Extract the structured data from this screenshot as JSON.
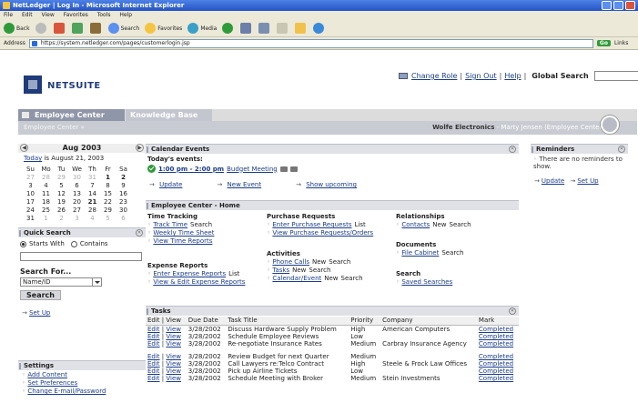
{
  "browser": {
    "title": "NetLedger | Log In - Microsoft Internet Explorer",
    "menu": [
      "File",
      "Edit",
      "View",
      "Favorites",
      "Tools",
      "Help"
    ],
    "toolbar": {
      "back": "Back",
      "search": "Search",
      "favorites": "Favorites",
      "media": "Media"
    },
    "address_label": "Address",
    "address": "https://system.netledger.com/pages/customerlogin.jsp",
    "go": "Go",
    "links": "Links"
  },
  "header": {
    "logo_text": "NETSUITE",
    "change_role": "Change Role",
    "sign_out": "Sign Out",
    "help": "Help",
    "global_search_label": "Global Search",
    "go": "Go"
  },
  "tabs": {
    "active": "Employee Center",
    "inactive": "Knowledge Base",
    "breadcrumb": "Employee Center »",
    "company": "Wolfe Electronics",
    "user": " - Marty Jensen (Employee Center)"
  },
  "calendar": {
    "month": "Aug 2003",
    "today_link": "Today",
    "today_text": " is August 21, 2003",
    "weekdays": [
      "Su",
      "Mo",
      "Tu",
      "We",
      "Th",
      "Fr",
      "Sa"
    ],
    "weeks": [
      [
        "27",
        "28",
        "29",
        "30",
        "31",
        "1",
        "2"
      ],
      [
        "3",
        "4",
        "5",
        "6",
        "7",
        "8",
        "9"
      ],
      [
        "10",
        "11",
        "12",
        "13",
        "14",
        "15",
        "16"
      ],
      [
        "17",
        "18",
        "19",
        "20",
        "21",
        "22",
        "23"
      ],
      [
        "24",
        "25",
        "26",
        "27",
        "28",
        "29",
        "30"
      ],
      [
        "31",
        "1",
        "2",
        "3",
        "4",
        "5",
        "6"
      ]
    ]
  },
  "quick_search": {
    "title": "Quick Search",
    "starts_with": "Starts With",
    "contains": "Contains",
    "search_for": "Search For...",
    "select_value": "Name/ID",
    "search_button": "Search",
    "setup": "Set Up"
  },
  "settings": {
    "title": "Settings",
    "items": [
      "Add Content",
      "Set Preferences",
      "Change E-mail/Password"
    ]
  },
  "calendar_events": {
    "title": "Calendar Events",
    "todays_events": "Today's events:",
    "event_time": "1:00 pm - 2:00 pm",
    "event_name": "Budget Meeting",
    "update": "Update",
    "new_event": "New Event",
    "show_upcoming": "Show upcoming"
  },
  "home": {
    "title": "Employee Center - Home",
    "time_tracking": {
      "h": "Time Tracking",
      "r1": "Track Time",
      "r1b": "Search",
      "r2": "Weekly Time Sheet",
      "r3": "View Time Reports"
    },
    "purchase": {
      "h": "Purchase Requests",
      "r1": "Enter Purchase Requests",
      "r1b": "List",
      "r2": "View Purchase Requests/Orders"
    },
    "relationships": {
      "h": "Relationships",
      "r1": "Contacts",
      "r1b": "New",
      "r1c": "Search"
    },
    "documents": {
      "h": "Documents",
      "r1": "File Cabinet",
      "r1b": "Search"
    },
    "expense": {
      "h": "Expense Reports",
      "r1": "Enter Expense Reports",
      "r1b": "List",
      "r2": "View & Edit Expense Reports"
    },
    "activities": {
      "h": "Activities",
      "r1": "Phone Calls",
      "r1b": "New",
      "r1c": "Search",
      "r2": "Tasks",
      "r2b": "New",
      "r2c": "Search",
      "r3": "Calendar/Event",
      "r3b": "New",
      "r3c": "Search"
    },
    "search": {
      "h": "Search",
      "r1": "Saved Searches"
    }
  },
  "tasks": {
    "title": "Tasks",
    "columns": [
      "Edit | View",
      "Due Date",
      "Task Title",
      "Priority",
      "Company",
      "Mark"
    ],
    "rows": [
      {
        "date": "3/28/2002",
        "title": "Discuss Hardware Supply Problem",
        "priority": "High",
        "company": "American Computers",
        "mark": "Completed"
      },
      {
        "date": "3/28/2002",
        "title": "Schedule Employee Reviews",
        "priority": "Low",
        "company": "",
        "mark": "Completed"
      },
      {
        "date": "3/28/2002",
        "title": "Re-negotiate Insurance Rates",
        "priority": "Medium",
        "company": "Carbray Insurance Agency",
        "mark": "Completed"
      },
      {
        "date": "3/28/2002",
        "title": "Review Budget for next Quarter",
        "priority": "Medium",
        "company": "",
        "mark": "Completed"
      },
      {
        "date": "3/28/2002",
        "title": "Call Lawyers re:Telco Contract",
        "priority": "High",
        "company": "Steele & Frock Law Offices",
        "mark": "Completed"
      },
      {
        "date": "3/28/2002",
        "title": "Pick up Airline Tickets",
        "priority": "Low",
        "company": "",
        "mark": "Completed"
      },
      {
        "date": "3/28/2002",
        "title": "Schedule Meeting with Broker",
        "priority": "Medium",
        "company": "Stein Investments",
        "mark": "Completed"
      }
    ],
    "edit": "Edit",
    "view": "View"
  },
  "reminders": {
    "title": "Reminders",
    "text": "There are no reminders to show.",
    "update": "Update",
    "setup": "Set Up"
  }
}
